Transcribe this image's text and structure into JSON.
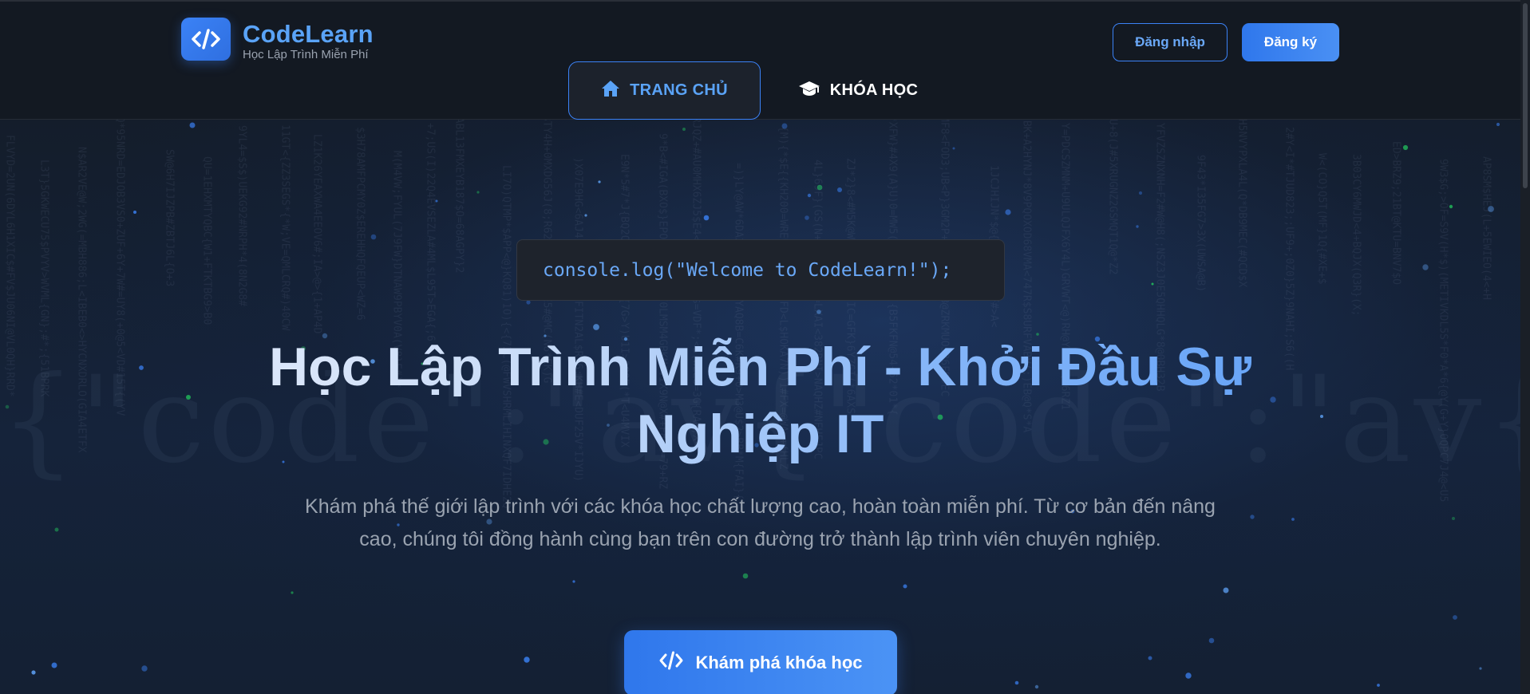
{
  "header": {
    "logo_title": "CodeLearn",
    "logo_subtitle": "Học Lập Trình Miễn Phí",
    "login_label": "Đăng nhập",
    "register_label": "Đăng ký",
    "nav": [
      {
        "label": "TRANG CHỦ",
        "icon": "home-icon",
        "active": true
      },
      {
        "label": "KHÓA HỌC",
        "icon": "graduation-cap-icon",
        "active": false
      }
    ]
  },
  "hero": {
    "code_snippet": "console.log(\"Welcome to CodeLearn!\");",
    "title": "Học Lập Trình Miễn Phí - Khởi Đầu Sự Nghiệp IT",
    "description": "Khám phá thế giới lập trình với các khóa học chất lượng cao, hoàn toàn miễn phí. Từ cơ bản đến nâng cao, chúng tôi đồng hành cùng bạn trên con đường trở thành lập trình viên chuyên nghiệp.",
    "cta_label": "Khám phá khóa học",
    "cta_icon": "code-icon",
    "background_watermark": "{\"code\":\"av{\"code\":\"av{\"c"
  },
  "colors": {
    "accent": "#3b82f6",
    "accent_light": "#5aa3f7",
    "background": "#0f141c",
    "header_bg": "#131922",
    "muted_text": "#9aa3b0"
  }
}
